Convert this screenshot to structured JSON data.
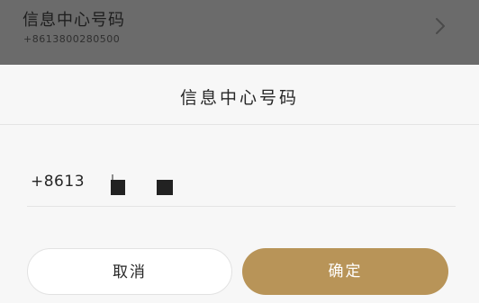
{
  "background_row": {
    "title": "信息中心号码",
    "subtitle": "+8613800280500",
    "chevron_icon": "chevron-right-icon"
  },
  "dialog": {
    "title": "信息中心号码",
    "input_value": "+8613",
    "masked_digits": "obscured"
  },
  "buttons": {
    "cancel_label": "取消",
    "confirm_label": "确定"
  },
  "colors": {
    "accent": "#b89458",
    "overlay": "#6b6b6b",
    "dialog_bg": "#f7f7f7"
  }
}
